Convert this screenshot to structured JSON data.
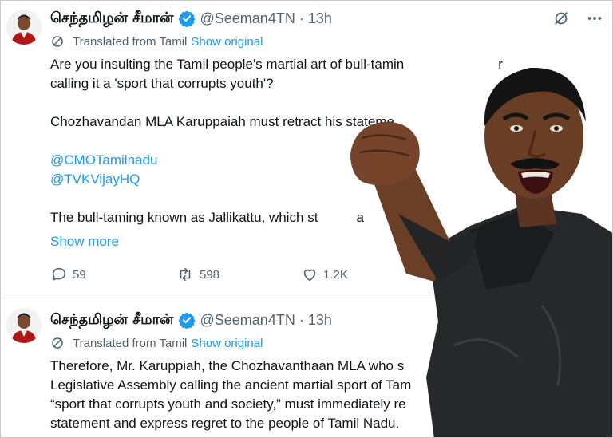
{
  "tweet1": {
    "name": "செந்தமிழன் சீமான்",
    "handle": "@Seeman4TN · 13h",
    "translated": "Translated from Tamil",
    "show_original": "Show original",
    "line1": "Are you insulting the Tamil people's martial art of bull-tamin",
    "line1b": "r",
    "line2": "calling it a 'sport that corrupts youth'?",
    "line3": "Chozhavandan MLA Karuppaiah must retract his stateme",
    "mention1": "@CMOTamilnadu",
    "mention2": "@TVKVijayHQ",
    "line4": "The bull-taming known as Jallikattu, which st",
    "line4b": "a",
    "show_more": "Show more",
    "replies": "59",
    "retweets": "598",
    "likes": "1.2K"
  },
  "tweet2": {
    "name": "செந்தமிழன் சீமான்",
    "handle": "@Seeman4TN · 13h",
    "translated": "Translated from Tamil",
    "show_original": "Show original",
    "line1": "Therefore, Mr. Karuppiah, the Chozhavanthaan MLA who s",
    "line2": "Legislative Assembly calling the ancient martial sport of Tam",
    "line3": "“sport that corrupts youth and society,” must immediately re",
    "line4": "statement and express regret to the people of Tamil Nadu."
  },
  "icons": {
    "grok": "grok-icon",
    "more": "more-icon",
    "verified": "verified-badge-icon",
    "translate": "globe-icon",
    "reply": "reply-icon",
    "retweet": "retweet-icon",
    "like": "like-icon"
  },
  "colors": {
    "accent": "#1d9bf0",
    "secondary_text": "#536471",
    "primary_text": "#0f1419"
  }
}
